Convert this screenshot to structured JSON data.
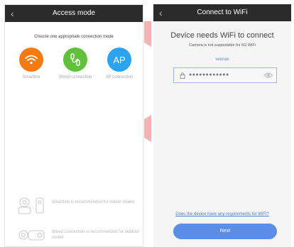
{
  "left": {
    "back_icon": "chevron-left-icon",
    "title": "Access mode",
    "subtitle": "Choose one appropriate connection mode",
    "modes": [
      {
        "label": "Smartlink",
        "icon": "wifi-icon",
        "color": "#f77a11"
      },
      {
        "label": "Wired connection",
        "icon": "cable-icon",
        "color": "#60c23a"
      },
      {
        "label": "AP connection",
        "icon_text": "AP",
        "color": "#2ba3ef"
      }
    ],
    "hints": [
      {
        "text": "Smartlink is recommended for indoor model"
      },
      {
        "text": "Wired connection is recommended for outdoor model"
      }
    ]
  },
  "right": {
    "back_icon": "chevron-left-icon",
    "title": "Connect to WiFi",
    "heading": "Device needs WiFi to connect",
    "note": "Camera is not supportable for 5G WiFi",
    "ssid": "seenax",
    "password_masked": "●●●●●●●●●●●●",
    "requirements_link": "Does the device have any requirements for WiFi?",
    "next_button": "Next"
  },
  "colors": {
    "nav_bg": "#2b2b2b",
    "accent": "#5b8de6",
    "decor_pink": "#f7b2b6"
  }
}
